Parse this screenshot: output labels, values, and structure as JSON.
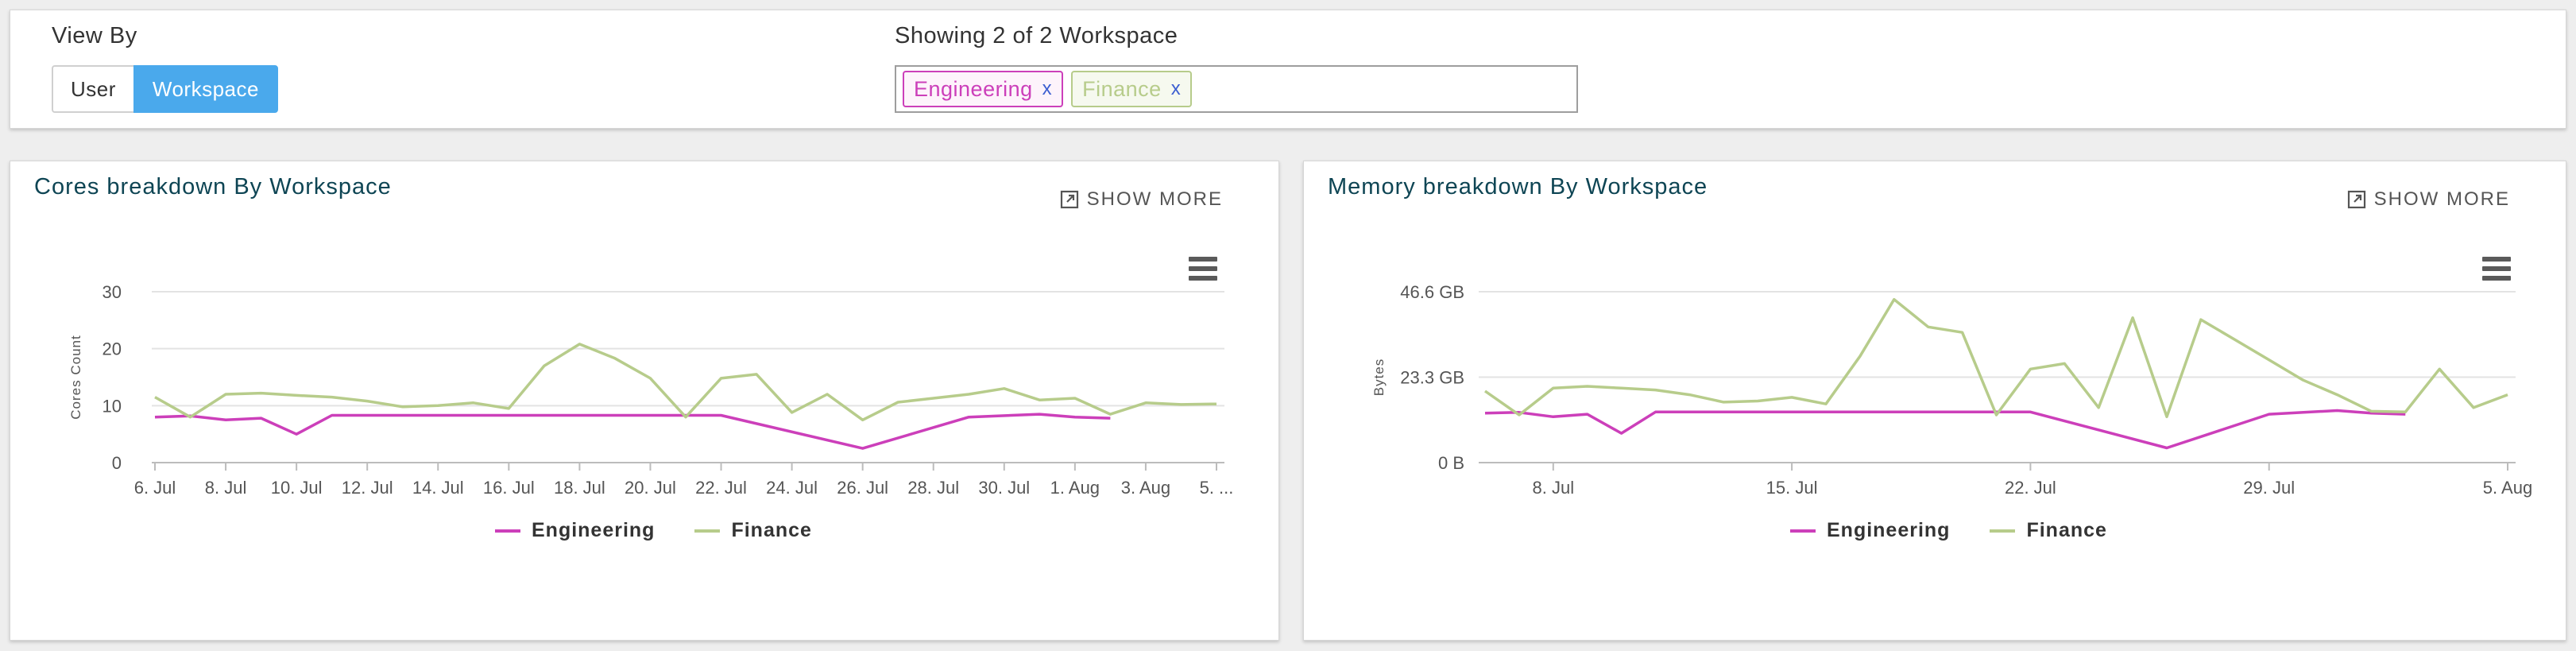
{
  "filter": {
    "view_by_label": "View By",
    "toggle": {
      "user_label": "User",
      "workspace_label": "Workspace",
      "active": "Workspace"
    },
    "showing_label": "Showing 2 of 2 Workspace",
    "tags": [
      {
        "label": "Engineering",
        "remove": "x",
        "color": "#cc3fba"
      },
      {
        "label": "Finance",
        "remove": "x",
        "color": "#b7cc8b"
      }
    ]
  },
  "colors": {
    "engineering": "#cc3fba",
    "finance": "#b7cc8b",
    "accent": "#4aa9ec",
    "title": "#0e4554"
  },
  "chart_data": [
    {
      "type": "line",
      "title": "Cores breakdown By Workspace",
      "show_more_label": "SHOW MORE",
      "ylabel": "Cores Count",
      "xlabel": "",
      "ylim": [
        0,
        30
      ],
      "yticks": [
        0,
        10,
        20,
        30
      ],
      "ytick_labels": [
        "0",
        "10",
        "20",
        "30"
      ],
      "x_start": "2024-07-06",
      "x_end": "2024-08-05",
      "xtick_labels": [
        "6. Jul",
        "8. Jul",
        "10. Jul",
        "12. Jul",
        "14. Jul",
        "16. Jul",
        "18. Jul",
        "20. Jul",
        "22. Jul",
        "24. Jul",
        "26. Jul",
        "28. Jul",
        "30. Jul",
        "1. Aug",
        "3. Aug",
        "5. ..."
      ],
      "xtick_days": [
        0,
        2,
        4,
        6,
        8,
        10,
        12,
        14,
        16,
        18,
        20,
        22,
        24,
        26,
        28,
        30
      ],
      "grid": true,
      "legend_position": "bottom-center",
      "series": [
        {
          "name": "Engineering",
          "color": "#cc3fba",
          "x": [
            0,
            1,
            2,
            3,
            4,
            5,
            6,
            7,
            8,
            9,
            10,
            11,
            12,
            13,
            14,
            15,
            16,
            20,
            23,
            25,
            26,
            27
          ],
          "y": [
            8,
            8.2,
            7.5,
            7.8,
            5,
            8.3,
            8.3,
            8.3,
            8.3,
            8.3,
            8.3,
            8.3,
            8.3,
            8.3,
            8.3,
            8.3,
            8.3,
            2.5,
            8,
            8.5,
            8,
            7.8
          ]
        },
        {
          "name": "Finance",
          "color": "#b7cc8b",
          "x": [
            0,
            1,
            2,
            3,
            4,
            5,
            6,
            7,
            8,
            9,
            10,
            11,
            12,
            13,
            14,
            15,
            16,
            17,
            18,
            19,
            20,
            21,
            22,
            23,
            24,
            25,
            26,
            27,
            28,
            29,
            30
          ],
          "y": [
            11.5,
            8,
            12,
            12.2,
            11.8,
            11.5,
            10.8,
            9.8,
            10,
            10.5,
            9.5,
            17,
            20.8,
            18.3,
            14.8,
            8,
            14.8,
            15.5,
            8.8,
            12,
            7.5,
            10.6,
            11.3,
            12,
            13,
            11,
            11.3,
            8.5,
            10.5,
            10.2,
            10.3
          ]
        }
      ]
    },
    {
      "type": "line",
      "title": "Memory breakdown By Workspace",
      "show_more_label": "SHOW MORE",
      "ylabel": "Bytes",
      "xlabel": "",
      "ylim": [
        0,
        46.6
      ],
      "yticks": [
        0,
        23.3,
        46.6
      ],
      "ytick_labels": [
        "0 B",
        "23.3 GB",
        "46.6 GB"
      ],
      "x_start": "2024-07-06",
      "x_end": "2024-08-05",
      "xtick_labels": [
        "8. Jul",
        "15. Jul",
        "22. Jul",
        "29. Jul",
        "5. Aug"
      ],
      "xtick_days": [
        2,
        9,
        16,
        23,
        30
      ],
      "grid": true,
      "legend_position": "bottom-center",
      "series": [
        {
          "name": "Engineering",
          "color": "#cc3fba",
          "x": [
            0,
            1,
            2,
            3,
            4,
            5,
            6,
            7,
            8,
            9,
            10,
            11,
            12,
            13,
            14,
            15,
            16,
            20,
            23,
            25,
            26,
            27
          ],
          "y": [
            13.5,
            13.7,
            12.5,
            13.2,
            8,
            13.8,
            13.8,
            13.8,
            13.8,
            13.8,
            13.8,
            13.8,
            13.8,
            13.8,
            13.8,
            13.8,
            13.8,
            4,
            13.2,
            14.2,
            13.5,
            13.2
          ]
        },
        {
          "name": "Finance",
          "color": "#b7cc8b",
          "x": [
            0,
            1,
            2,
            3,
            4,
            5,
            6,
            7,
            8,
            9,
            10,
            11,
            12,
            13,
            14,
            15,
            16,
            17,
            18,
            19,
            20,
            21,
            22,
            23,
            24,
            25,
            26,
            27,
            28,
            29,
            30
          ],
          "y": [
            19.5,
            13,
            20.3,
            20.8,
            20.3,
            19.8,
            18.5,
            16.5,
            16.8,
            17.8,
            16,
            29,
            44.5,
            37,
            35.5,
            13,
            25.5,
            27,
            15,
            39.5,
            12.5,
            39,
            33.5,
            28,
            22.5,
            18.5,
            14,
            13.8,
            25.5,
            15,
            18.5
          ]
        }
      ]
    }
  ]
}
